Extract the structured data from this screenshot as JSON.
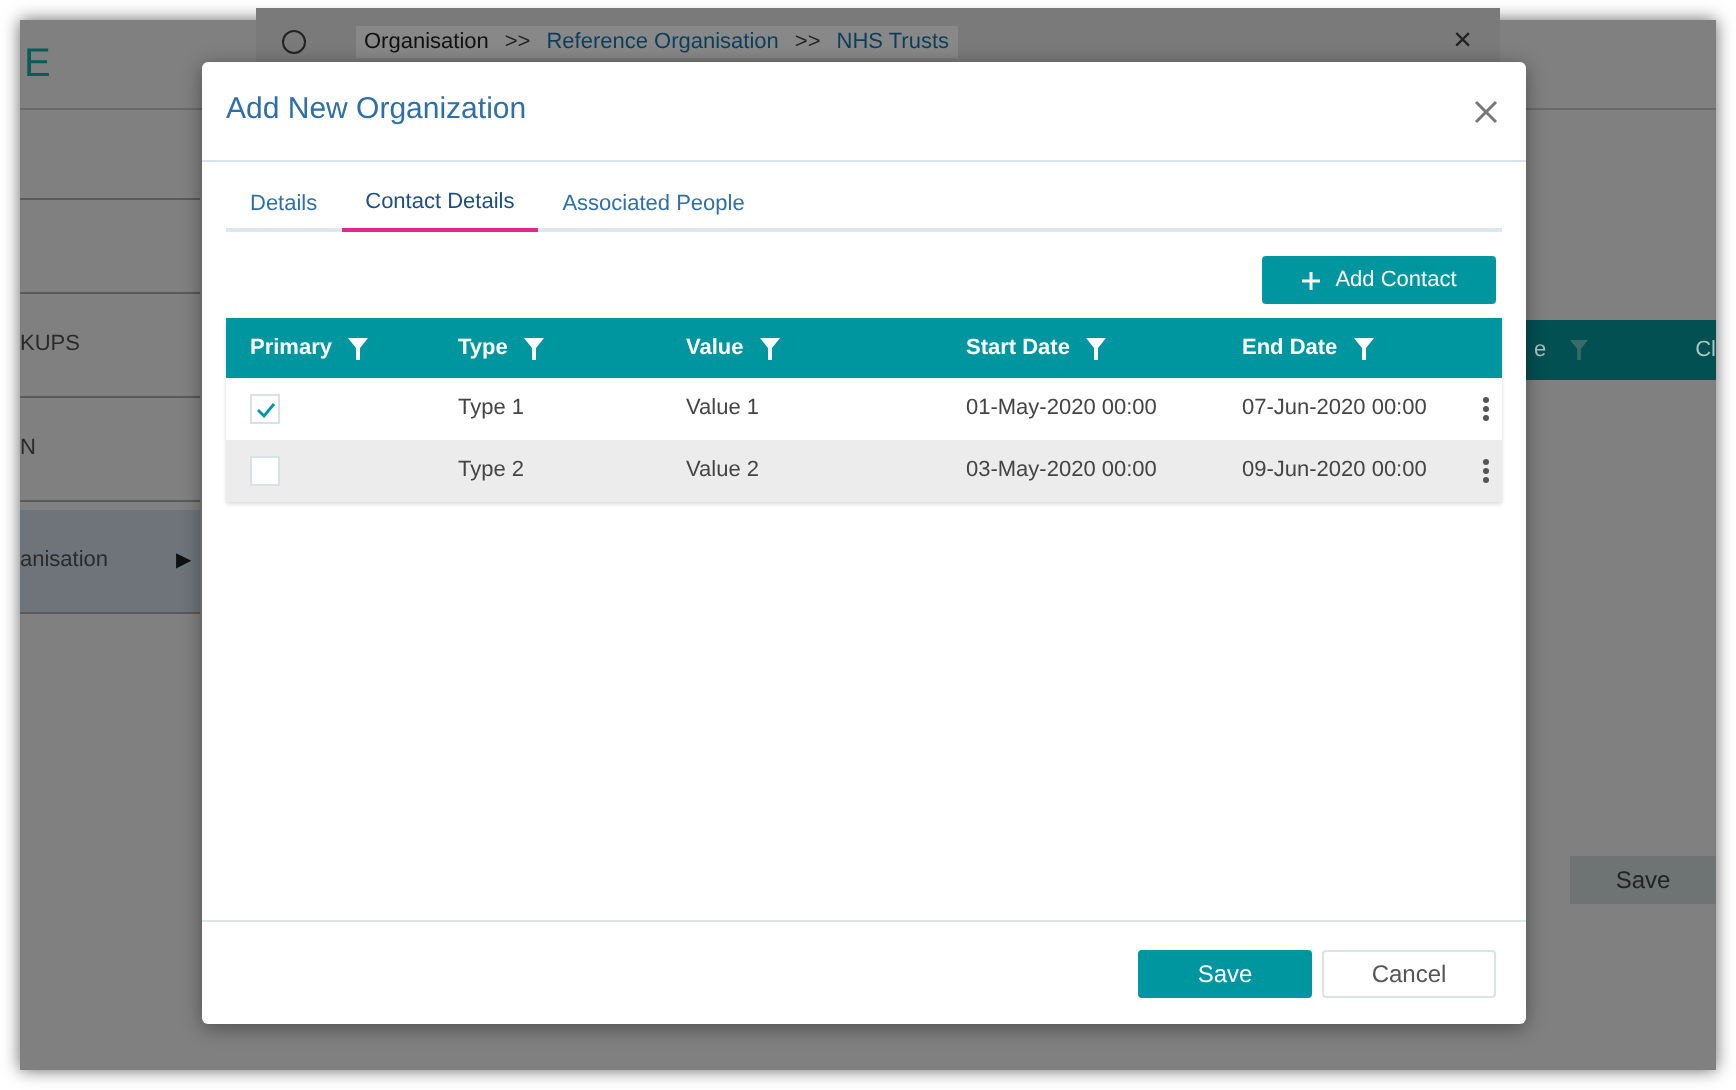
{
  "background": {
    "logo": "E",
    "breadcrumb": [
      {
        "label": "Organisation",
        "current": false
      },
      {
        "label": "Reference Organisation",
        "current": true
      },
      {
        "label": "NHS Trusts",
        "current": true
      }
    ],
    "breadcrumb_separator": ">>",
    "breadcrumb_close": "×",
    "sidebar_items": [
      {
        "label": "KUPS",
        "selected": false
      },
      {
        "label": "N",
        "selected": false
      },
      {
        "label": "anisation",
        "selected": true,
        "arrow": "▶"
      }
    ],
    "table_header": [
      "e",
      "Cl"
    ],
    "save_button": "Save"
  },
  "dialog": {
    "title": "Add New Organization",
    "tabs": [
      {
        "label": "Details",
        "selected": false
      },
      {
        "label": "Contact Details",
        "selected": true
      },
      {
        "label": "Associated People",
        "selected": false
      }
    ],
    "add_button": "Add Contact",
    "columns": [
      "Primary",
      "Type",
      "Value",
      "Start Date",
      "End Date"
    ],
    "rows": [
      {
        "primary": true,
        "type": "Type 1",
        "value": "Value 1",
        "start": "01-May-2020 00:00",
        "end": "07-Jun-2020 00:00"
      },
      {
        "primary": false,
        "type": "Type 2",
        "value": "Value 2",
        "start": "03-May-2020 00:00",
        "end": "09-Jun-2020 00:00"
      }
    ],
    "buttons": [
      {
        "label": "Save",
        "kind": "primary"
      },
      {
        "label": "Cancel",
        "kind": "secondary"
      }
    ]
  }
}
